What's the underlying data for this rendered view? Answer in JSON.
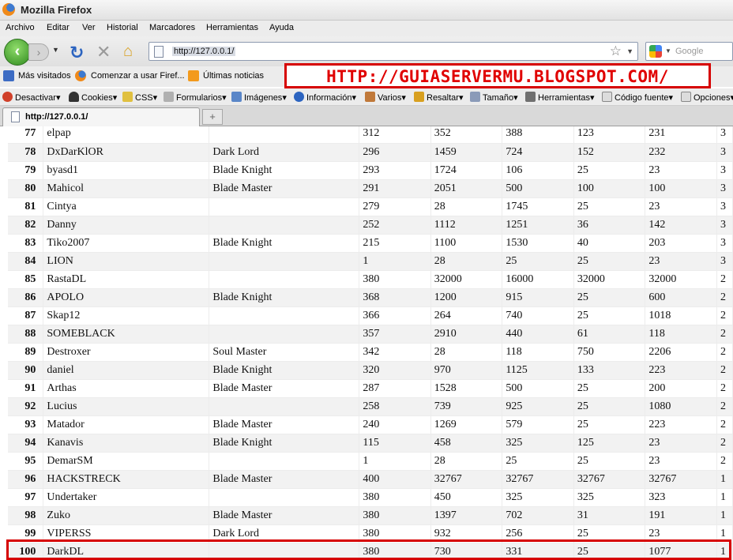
{
  "window": {
    "title": "Mozilla Firefox"
  },
  "menu": [
    "Archivo",
    "Editar",
    "Ver",
    "Historial",
    "Marcadores",
    "Herramientas",
    "Ayuda"
  ],
  "nav": {
    "url": "http://127.0.0.1/",
    "search_placeholder": "Google"
  },
  "bookmarks": [
    "Más visitados",
    "Comenzar a usar Firef...",
    "Últimas noticias"
  ],
  "banner": "HTTP://GUIASERVERMU.BLOGSPOT.COM/",
  "devbar": [
    "Desactivar",
    "Cookies",
    "CSS",
    "Formularios",
    "Imágenes",
    "Información",
    "Varios",
    "Resaltar",
    "Tamaño",
    "Herramientas",
    "Código fuente",
    "Opciones"
  ],
  "tab": {
    "label": "http://127.0.0.1/",
    "new_tab": "+"
  },
  "accent_color": "#d60000",
  "rows": [
    [
      "77",
      "elpap",
      "",
      "312",
      "352",
      "388",
      "123",
      "231",
      "3"
    ],
    [
      "78",
      "DxDarKlOR",
      "Dark Lord",
      "296",
      "1459",
      "724",
      "152",
      "232",
      "3"
    ],
    [
      "79",
      "byasd1",
      "Blade Knight",
      "293",
      "1724",
      "106",
      "25",
      "23",
      "3"
    ],
    [
      "80",
      "Mahicol",
      "Blade Master",
      "291",
      "2051",
      "500",
      "100",
      "100",
      "3"
    ],
    [
      "81",
      "Cintya",
      "",
      "279",
      "28",
      "1745",
      "25",
      "23",
      "3"
    ],
    [
      "82",
      "Danny",
      "",
      "252",
      "1112",
      "1251",
      "36",
      "142",
      "3"
    ],
    [
      "83",
      "Tiko2007",
      "Blade Knight",
      "215",
      "1100",
      "1530",
      "40",
      "203",
      "3"
    ],
    [
      "84",
      "LION",
      "",
      "1",
      "28",
      "25",
      "25",
      "23",
      "3"
    ],
    [
      "85",
      "RastaDL",
      "",
      "380",
      "32000",
      "16000",
      "32000",
      "32000",
      "2"
    ],
    [
      "86",
      "APOLO",
      "Blade Knight",
      "368",
      "1200",
      "915",
      "25",
      "600",
      "2"
    ],
    [
      "87",
      "Skap12",
      "",
      "366",
      "264",
      "740",
      "25",
      "1018",
      "2"
    ],
    [
      "88",
      "SOMEBLACK",
      "",
      "357",
      "2910",
      "440",
      "61",
      "118",
      "2"
    ],
    [
      "89",
      "Destroxer",
      "Soul Master",
      "342",
      "28",
      "118",
      "750",
      "2206",
      "2"
    ],
    [
      "90",
      "daniel",
      "Blade Knight",
      "320",
      "970",
      "1125",
      "133",
      "223",
      "2"
    ],
    [
      "91",
      "Arthas",
      "Blade Master",
      "287",
      "1528",
      "500",
      "25",
      "200",
      "2"
    ],
    [
      "92",
      "Lucius",
      "",
      "258",
      "739",
      "925",
      "25",
      "1080",
      "2"
    ],
    [
      "93",
      "Matador",
      "Blade Master",
      "240",
      "1269",
      "579",
      "25",
      "223",
      "2"
    ],
    [
      "94",
      "Kanavis",
      "Blade Knight",
      "115",
      "458",
      "325",
      "125",
      "23",
      "2"
    ],
    [
      "95",
      "DemarSM",
      "",
      "1",
      "28",
      "25",
      "25",
      "23",
      "2"
    ],
    [
      "96",
      "HACKSTRECK",
      "Blade Master",
      "400",
      "32767",
      "32767",
      "32767",
      "32767",
      "1"
    ],
    [
      "97",
      "Undertaker",
      "",
      "380",
      "450",
      "325",
      "325",
      "323",
      "1"
    ],
    [
      "98",
      "Zuko",
      "Blade Master",
      "380",
      "1397",
      "702",
      "31",
      "191",
      "1"
    ],
    [
      "99",
      "VIPERSS",
      "Dark Lord",
      "380",
      "932",
      "256",
      "25",
      "23",
      "1"
    ],
    [
      "100",
      "DarkDL",
      "",
      "380",
      "730",
      "331",
      "25",
      "1077",
      "1"
    ]
  ]
}
